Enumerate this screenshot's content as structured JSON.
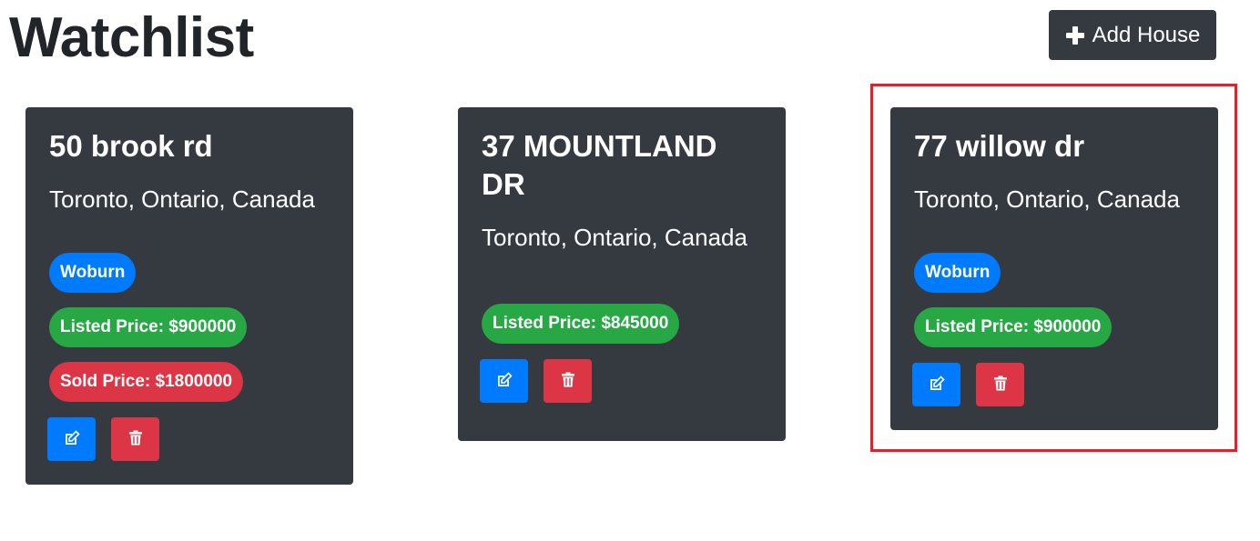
{
  "page": {
    "title": "Watchlist"
  },
  "toolbar": {
    "add_house_label": "Add House",
    "add_house_icon": "plus-icon"
  },
  "colors": {
    "card_bg": "#343a40",
    "primary": "#007bff",
    "success": "#28a745",
    "danger": "#dc3545",
    "highlight": "#e4202b"
  },
  "houses": [
    {
      "address": "50 brook rd",
      "location": "Toronto, Ontario, Canada",
      "neighbourhood": "Woburn",
      "listed_price": "Listed Price: $900000",
      "sold_price": "Sold Price: $1800000",
      "edit_icon": "edit-icon",
      "delete_icon": "trash-icon"
    },
    {
      "address": "37 MOUNTLAND DR",
      "location": "Toronto, Ontario, Canada",
      "listed_price": "Listed Price: $845000",
      "edit_icon": "edit-icon",
      "delete_icon": "trash-icon"
    },
    {
      "address": "77 willow dr",
      "location": "Toronto, Ontario, Canada",
      "neighbourhood": "Woburn",
      "listed_price": "Listed Price: $900000",
      "edit_icon": "edit-icon",
      "delete_icon": "trash-icon"
    }
  ]
}
